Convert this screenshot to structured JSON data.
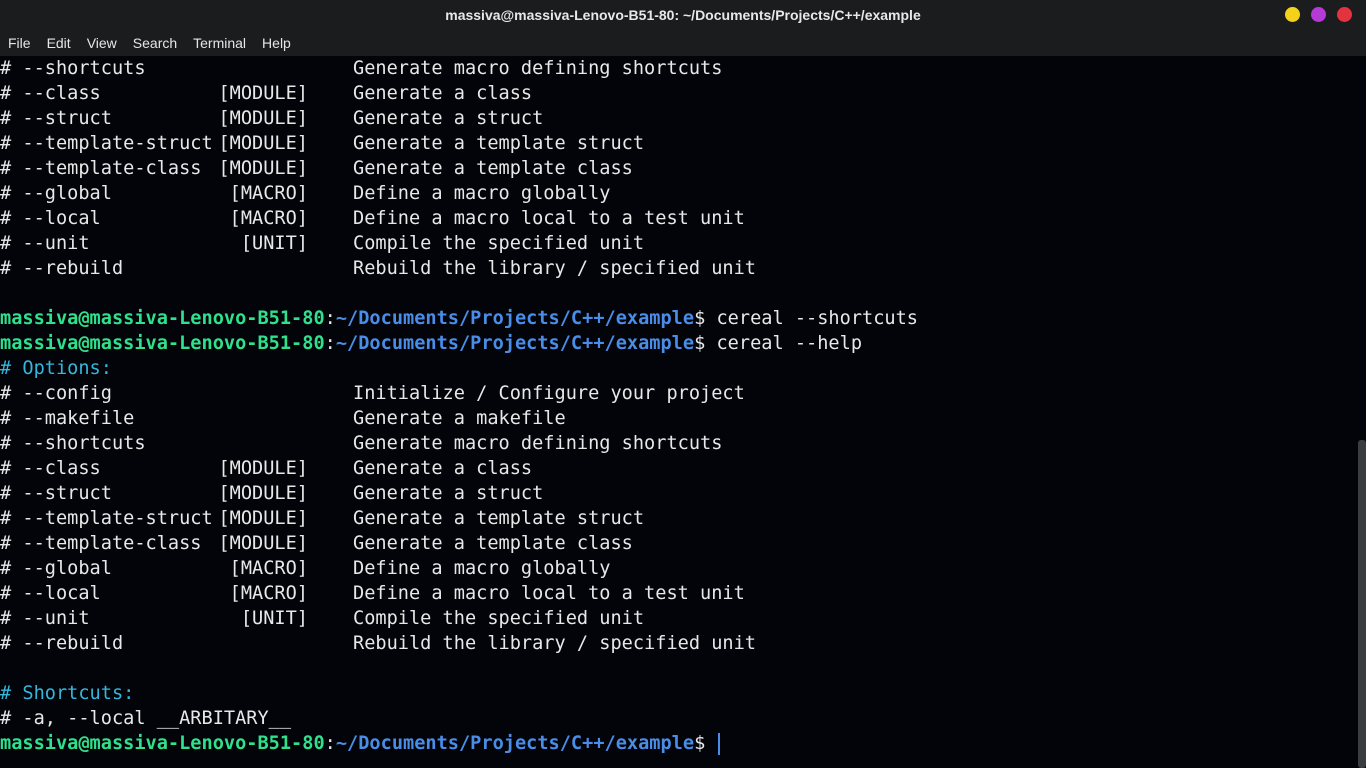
{
  "window": {
    "title": "massiva@massiva-Lenovo-B51-80: ~/Documents/Projects/C++/example",
    "controls": [
      {
        "name": "minimize",
        "color": "#f5d21a"
      },
      {
        "name": "maximize",
        "color": "#b53ad6"
      },
      {
        "name": "close",
        "color": "#e2333f"
      }
    ]
  },
  "menu": [
    "File",
    "Edit",
    "View",
    "Search",
    "Terminal",
    "Help"
  ],
  "prompt": {
    "user": "massiva@massiva-Lenovo-B51-80",
    "colon": ":",
    "path": "~/Documents/Projects/C++/example",
    "symbol": "$"
  },
  "lines": [
    {
      "type": "opt",
      "flag": "# --shortcuts",
      "arg": "",
      "desc": "Generate macro defining shortcuts"
    },
    {
      "type": "opt",
      "flag": "# --class",
      "arg": "[MODULE]",
      "desc": "Generate a class"
    },
    {
      "type": "opt",
      "flag": "# --struct",
      "arg": "[MODULE]",
      "desc": "Generate a struct"
    },
    {
      "type": "opt",
      "flag": "# --template-struct",
      "arg": "[MODULE]",
      "desc": "Generate a template struct"
    },
    {
      "type": "opt",
      "flag": "# --template-class",
      "arg": "[MODULE]",
      "desc": "Generate a template class"
    },
    {
      "type": "opt",
      "flag": "# --global",
      "arg": "[MACRO]",
      "desc": "Define a macro globally"
    },
    {
      "type": "opt",
      "flag": "# --local",
      "arg": "[MACRO]",
      "desc": "Define a macro local to a test unit"
    },
    {
      "type": "opt",
      "flag": "# --unit",
      "arg": "[UNIT]",
      "desc": "Compile the specified unit"
    },
    {
      "type": "opt",
      "flag": "# --rebuild",
      "arg": "",
      "desc": "Rebuild the library / specified unit"
    },
    {
      "type": "blank"
    },
    {
      "type": "prompt",
      "cmd": "cereal --shortcuts"
    },
    {
      "type": "prompt",
      "cmd": "cereal --help"
    },
    {
      "type": "section",
      "text": "# Options:"
    },
    {
      "type": "opt",
      "flag": "# --config",
      "arg": "",
      "desc": "Initialize / Configure your project"
    },
    {
      "type": "opt",
      "flag": "# --makefile",
      "arg": "",
      "desc": "Generate a makefile"
    },
    {
      "type": "opt",
      "flag": "# --shortcuts",
      "arg": "",
      "desc": "Generate macro defining shortcuts"
    },
    {
      "type": "opt",
      "flag": "# --class",
      "arg": "[MODULE]",
      "desc": "Generate a class"
    },
    {
      "type": "opt",
      "flag": "# --struct",
      "arg": "[MODULE]",
      "desc": "Generate a struct"
    },
    {
      "type": "opt",
      "flag": "# --template-struct",
      "arg": "[MODULE]",
      "desc": "Generate a template struct"
    },
    {
      "type": "opt",
      "flag": "# --template-class",
      "arg": "[MODULE]",
      "desc": "Generate a template class"
    },
    {
      "type": "opt",
      "flag": "# --global",
      "arg": "[MACRO]",
      "desc": "Define a macro globally"
    },
    {
      "type": "opt",
      "flag": "# --local",
      "arg": "[MACRO]",
      "desc": "Define a macro local to a test unit"
    },
    {
      "type": "opt",
      "flag": "# --unit",
      "arg": "[UNIT]",
      "desc": "Compile the specified unit"
    },
    {
      "type": "opt",
      "flag": "# --rebuild",
      "arg": "",
      "desc": "Rebuild the library / specified unit"
    },
    {
      "type": "blank"
    },
    {
      "type": "section",
      "text": "# Shortcuts:"
    },
    {
      "type": "plain",
      "text": "# -a, --local __ARBITARY__"
    },
    {
      "type": "prompt",
      "cmd": "",
      "cursor": true
    }
  ]
}
